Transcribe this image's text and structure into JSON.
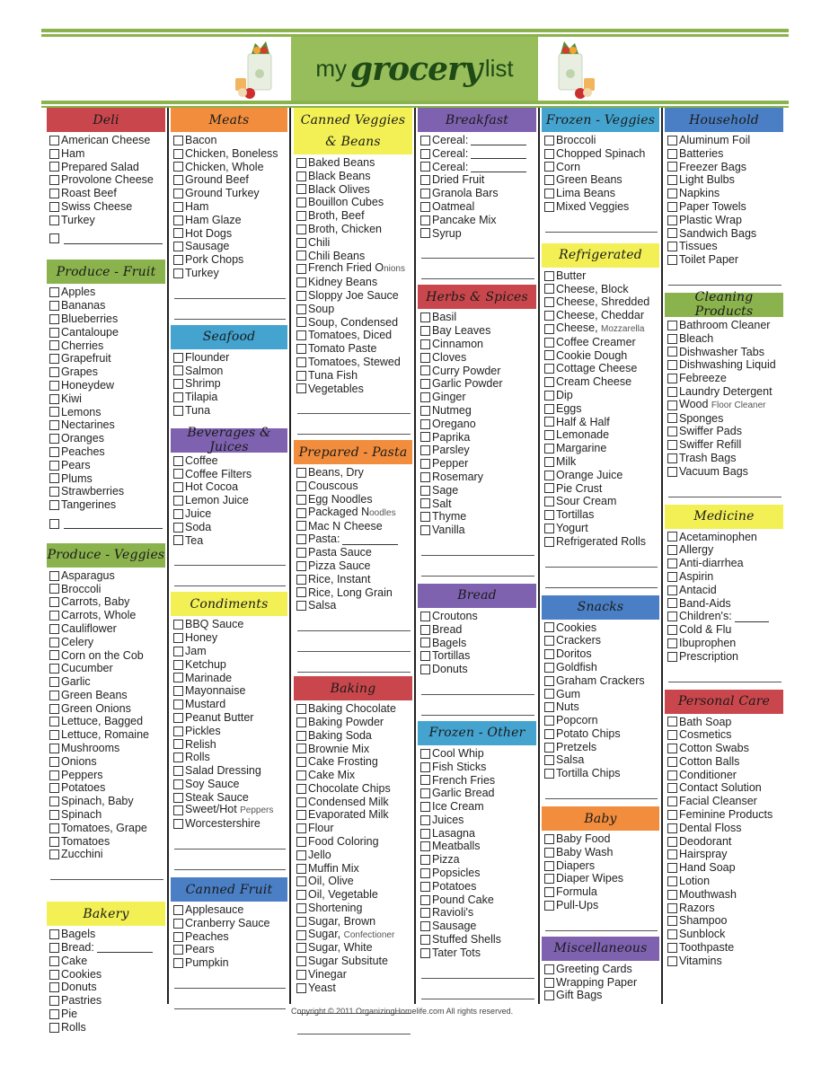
{
  "header": {
    "title_my": "my",
    "title_grocery": "grocery",
    "title_list": "list",
    "accent_color": "#98bd5b"
  },
  "columns": [
    {
      "sections": [
        {
          "title": "Deli",
          "color": "#c9474c",
          "items": [
            "American Cheese",
            "Ham",
            "Prepared Salad",
            "Provolone Cheese",
            "Roast Beef",
            "Swiss Cheese",
            "Turkey"
          ],
          "blank_item": true
        },
        {
          "title": "Produce - Fruit",
          "color": "#8bb34d",
          "items": [
            "Apples",
            "Bananas",
            "Blueberries",
            "Cantaloupe",
            "Cherries",
            "Grapefruit",
            "Grapes",
            "Honeydew",
            "Kiwi",
            "Lemons",
            "Nectarines",
            "Oranges",
            "Peaches",
            "Pears",
            "Plums",
            "Strawberries",
            "Tangerines"
          ],
          "blank_item": true
        },
        {
          "title": "Produce - Veggies",
          "color": "#8bb34d",
          "items": [
            "Asparagus",
            "Broccoli",
            "Carrots, Baby",
            "Carrots, Whole",
            "Cauliflower",
            "Celery",
            "Corn on the Cob",
            "Cucumber",
            "Garlic",
            "Green Beans",
            "Green Onions",
            "Lettuce, Bagged",
            "Lettuce, Romaine",
            "Mushrooms",
            "Onions",
            "Peppers",
            "Potatoes",
            "Spinach, Baby",
            "Spinach",
            "Tomatoes, Grape",
            "Tomatoes",
            "Zucchini"
          ]
        },
        {
          "title": "Bakery",
          "color": "#f2f054",
          "items": [
            "Bagels",
            "Bread:",
            "Cake",
            "Cookies",
            "Donuts",
            "Pastries",
            "Pie",
            "Rolls"
          ]
        }
      ]
    },
    {
      "sections": [
        {
          "title": "Meats",
          "color": "#f18d3d",
          "items": [
            "Bacon",
            "Chicken, Boneless",
            "Chicken, Whole",
            "Ground Beef",
            "Ground Turkey",
            "Ham",
            "Ham Glaze",
            "Hot Dogs",
            "Sausage",
            "Pork Chops",
            "Turkey"
          ]
        },
        {
          "title": "Seafood",
          "color": "#44a4cf",
          "items": [
            "Flounder",
            "Salmon",
            "Shrimp",
            "Tilapia",
            "Tuna"
          ]
        },
        {
          "title": "Beverages & Juices",
          "color": "#7e62b0",
          "items": [
            "Coffee",
            "Coffee Filters",
            "Hot Cocoa",
            "Lemon Juice",
            "Juice",
            "Soda",
            "Tea"
          ]
        },
        {
          "title": "Condiments",
          "color": "#f2f054",
          "items": [
            "BBQ Sauce",
            "Honey",
            "Jam",
            "Ketchup",
            "Marinade",
            "Mayonnaise",
            "Mustard",
            "Peanut Butter",
            "Pickles",
            "Relish",
            "Rolls",
            "Salad Dressing",
            "Soy Sauce",
            "Steak Sauce",
            "Sweet/Hot Peppers",
            "Worcestershire"
          ]
        },
        {
          "title": "Canned Fruit",
          "color": "#4a7fc5",
          "items": [
            "Applesauce",
            "Cranberry Sauce",
            "Peaches",
            "Pears",
            "Pumpkin"
          ]
        }
      ]
    },
    {
      "sections": [
        {
          "title": "Canned Veggies",
          "title2": "& Beans",
          "color": "#f2f054",
          "items": [
            "Baked Beans",
            "Black Beans",
            "Black Olives",
            "Bouillon Cubes",
            "Broth, Beef",
            "Broth, Chicken",
            "Chili",
            "Chili Beans",
            "French Fried Onions",
            "Kidney Beans",
            "Sloppy Joe Sauce",
            "Soup",
            "Soup, Condensed",
            "Tomatoes, Diced",
            "Tomato Paste",
            "Tomatoes, Stewed",
            "Tuna Fish",
            "Vegetables"
          ]
        },
        {
          "title": "Prepared - Pasta",
          "color": "#f18d3d",
          "items": [
            "Beans, Dry",
            "Couscous",
            "Egg Noodles",
            "Packaged Noodles",
            "Mac N Cheese",
            "Pasta:",
            "Pasta Sauce",
            "Pizza Sauce",
            "Rice, Instant",
            "Rice, Long Grain",
            "Salsa"
          ]
        },
        {
          "title": "Baking",
          "color": "#c9474c",
          "items": [
            "Baking Chocolate",
            "Baking Powder",
            "Baking Soda",
            "Brownie Mix",
            "Cake Frosting",
            "Cake Mix",
            "Chocolate Chips",
            "Condensed Milk",
            "Evaporated Milk",
            "Flour",
            "Food Coloring",
            "Jello",
            "Muffin Mix",
            "Oil, Olive",
            "Oil, Vegetable",
            "Shortening",
            "Sugar, Brown",
            "Sugar, Confectioner",
            "Sugar, White",
            "Sugar Subsitute",
            "Vinegar",
            "Yeast"
          ]
        }
      ]
    },
    {
      "sections": [
        {
          "title": "Breakfast",
          "color": "#7e62b0",
          "items": [
            "Cereal:",
            "Cereal:",
            "Cereal:",
            "Dried Fruit",
            "Granola Bars",
            "Oatmeal",
            "Pancake Mix",
            "Syrup"
          ]
        },
        {
          "title": "Herbs & Spices",
          "color": "#c9474c",
          "items": [
            "Basil",
            "Bay Leaves",
            "Cinnamon",
            "Cloves",
            "Curry Powder",
            "Garlic Powder",
            "Ginger",
            "Nutmeg",
            "Oregano",
            "Paprika",
            "Parsley",
            "Pepper",
            "Rosemary",
            "Sage",
            "Salt",
            "Thyme",
            "Vanilla"
          ]
        },
        {
          "title": "Bread",
          "color": "#7e62b0",
          "items": [
            "Croutons",
            "Bread",
            "Bagels",
            "Tortillas",
            "Donuts"
          ]
        },
        {
          "title": "Frozen - Other",
          "color": "#44a4cf",
          "items": [
            "Cool Whip",
            "Fish Sticks",
            "French Fries",
            "Garlic Bread",
            "Ice Cream",
            "Juices",
            "Lasagna",
            "Meatballs",
            "Pizza",
            "Popsicles",
            "Potatoes",
            "Pound Cake",
            "Ravioli's",
            "Sausage",
            "Stuffed Shells",
            "Tater Tots"
          ]
        }
      ]
    },
    {
      "sections": [
        {
          "title": "Frozen - Veggies",
          "color": "#44a4cf",
          "items": [
            "Broccoli",
            "Chopped Spinach",
            "Corn",
            "Green Beans",
            "Lima Beans",
            "Mixed Veggies"
          ]
        },
        {
          "title": "Refrigerated",
          "color": "#f2f054",
          "items": [
            "Butter",
            "Cheese, Block",
            "Cheese, Shredded",
            "Cheese, Cheddar",
            "Cheese, Mozzarella",
            "Coffee Creamer",
            "Cookie Dough",
            "Cottage Cheese",
            "Cream Cheese",
            "Dip",
            "Eggs",
            "Half & Half",
            "Lemonade",
            "Margarine",
            "Milk",
            "Orange Juice",
            "Pie Crust",
            "Sour Cream",
            "Tortillas",
            "Yogurt",
            "Refrigerated Rolls"
          ]
        },
        {
          "title": "Snacks",
          "color": "#4a7fc5",
          "items": [
            "Cookies",
            "Crackers",
            "Doritos",
            "Goldfish",
            "Graham Crackers",
            "Gum",
            "Nuts",
            "Popcorn",
            "Potato Chips",
            "Pretzels",
            "Salsa",
            "Tortilla Chips"
          ]
        },
        {
          "title": "Baby",
          "color": "#f18d3d",
          "items": [
            "Baby Food",
            "Baby Wash",
            "Diapers",
            "Diaper Wipes",
            "Formula",
            "Pull-Ups"
          ]
        },
        {
          "title": "Miscellaneous",
          "color": "#7e62b0",
          "items": [
            "Greeting Cards",
            "Wrapping Paper",
            "Gift Bags"
          ]
        }
      ]
    },
    {
      "sections": [
        {
          "title": "Household",
          "color": "#4a7fc5",
          "items": [
            "Aluminum Foil",
            "Batteries",
            "Freezer Bags",
            "Light Bulbs",
            "Napkins",
            "Paper Towels",
            "Plastic Wrap",
            "Sandwich Bags",
            "Tissues",
            "Toilet Paper"
          ]
        },
        {
          "title": "Cleaning Products",
          "color": "#8bb34d",
          "items": [
            "Bathroom Cleaner",
            "Bleach",
            "Dishwasher Tabs",
            "Dishwashing Liquid",
            "Febreeze",
            "Laundry Detergent",
            "Wood Floor Cleaner",
            "Sponges",
            "Swiffer Pads",
            "Swiffer Refill",
            "Trash Bags",
            "Vacuum Bags"
          ]
        },
        {
          "title": "Medicine",
          "color": "#f2f054",
          "items": [
            "Acetaminophen",
            "Allergy",
            "Anti-diarrhea",
            "Aspirin",
            "Antacid",
            "Band-Aids",
            "Children's:",
            "Cold & Flu",
            "Ibuprophen",
            "Prescription"
          ]
        },
        {
          "title": "Personal Care",
          "color": "#c9474c",
          "items": [
            "Bath Soap",
            "Cosmetics",
            "Cotton Swabs",
            "Cotton Balls",
            "Conditioner",
            "Contact Solution",
            "Facial Cleanser",
            "Feminine Products",
            "Dental Floss",
            "Deodorant",
            "Hairspray",
            "Hand Soap",
            "Lotion",
            "Mouthwash",
            "Razors",
            "Shampoo",
            "Sunblock",
            "Toothpaste",
            "Vitamins"
          ]
        }
      ]
    }
  ],
  "footer": {
    "copyright": "Copyright © 2011 OrganizingHomelife.com     All rights reserved."
  }
}
